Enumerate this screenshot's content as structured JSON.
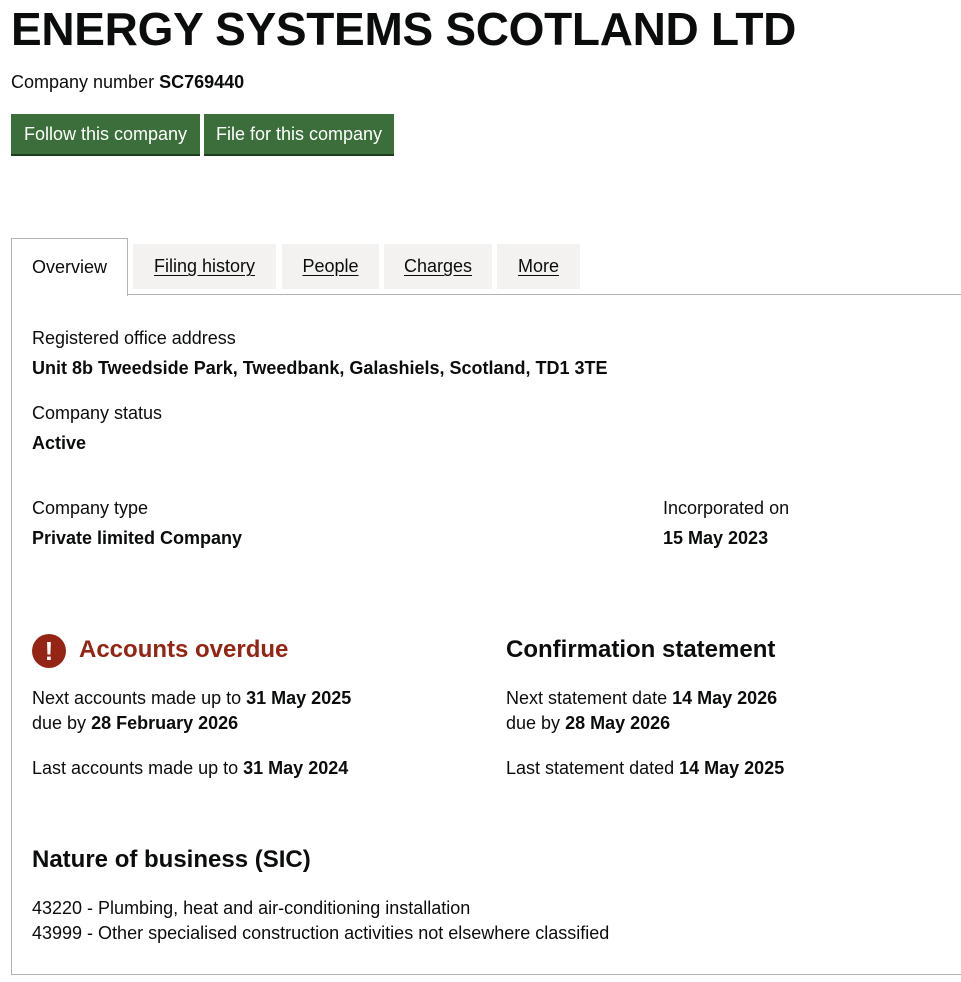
{
  "company": {
    "name": "ENERGY SYSTEMS SCOTLAND LTD",
    "number_label": "Company number",
    "number": "SC769440"
  },
  "actions": {
    "follow_label": "Follow this company",
    "file_label": "File for this company"
  },
  "tabs": [
    {
      "label": "Overview",
      "active": true
    },
    {
      "label": "Filing history",
      "active": false
    },
    {
      "label": "People",
      "active": false
    },
    {
      "label": "Charges",
      "active": false
    },
    {
      "label": "More",
      "active": false
    }
  ],
  "overview": {
    "address_label": "Registered office address",
    "address": "Unit 8b Tweedside Park, Tweedbank, Galashiels, Scotland, TD1 3TE",
    "status_label": "Company status",
    "status": "Active",
    "type_label": "Company type",
    "type": "Private limited Company",
    "incorporated_label": "Incorporated on",
    "incorporated": "15 May 2023"
  },
  "accounts": {
    "heading": "Accounts overdue",
    "icon": "exclamation-icon",
    "next_prefix": "Next accounts made up to",
    "next_date": "31 May 2025",
    "due_prefix": "due by",
    "due_date": "28 February 2026",
    "last_prefix": "Last accounts made up to",
    "last_date": "31 May 2024"
  },
  "confirmation": {
    "heading": "Confirmation statement",
    "next_prefix": "Next statement date",
    "next_date": "14 May 2026",
    "due_prefix": "due by",
    "due_date": "28 May 2026",
    "last_prefix": "Last statement dated",
    "last_date": "14 May 2025"
  },
  "sic": {
    "heading": "Nature of business (SIC)",
    "items": [
      "43220 - Plumbing, heat and air-conditioning installation",
      "43999 - Other specialised construction activities not elsewhere classified"
    ]
  },
  "colors": {
    "button_green": "#3b6e3b",
    "overdue_red": "#942514",
    "tab_grey": "#f3f2f1",
    "border_grey": "#b1b4b6"
  }
}
